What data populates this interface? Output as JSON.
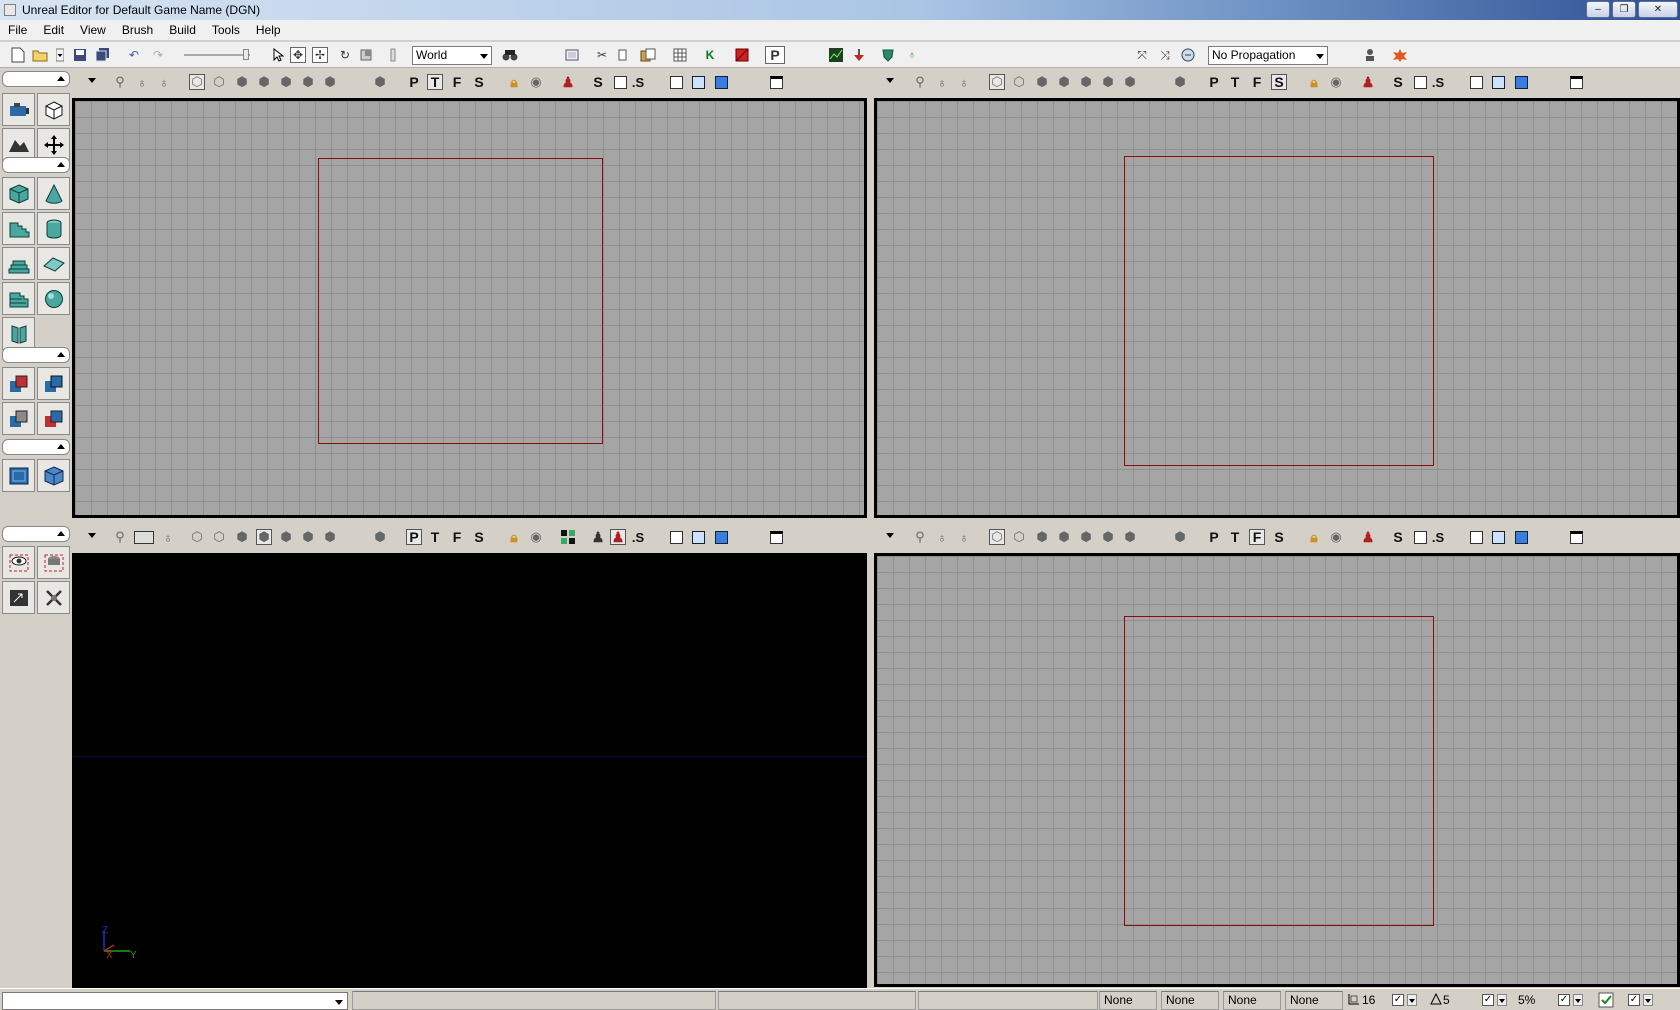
{
  "window": {
    "title": "Unreal Editor for Default Game Name (DGN)",
    "min_glyph": "–",
    "restore_glyph": "❐",
    "close_glyph": "✕"
  },
  "menu": [
    "File",
    "Edit",
    "View",
    "Brush",
    "Build",
    "Tools",
    "Help"
  ],
  "toolbar": {
    "coordinate_system": "World",
    "propagation": "No Propagation",
    "icons": [
      "new-map-icon",
      "open-icon",
      "save-icon",
      "save-all-icon",
      "undo-icon",
      "redo-icon",
      "select-icon",
      "translate-icon",
      "rotate-icon",
      "find-icon",
      "cut-icon",
      "copy-icon",
      "paste-icon",
      "grid-icon",
      "kismet-icon",
      "red-box-icon",
      "play-icon",
      "stats-icon",
      "build-icon",
      "propagate-icon"
    ],
    "p_label": "P"
  },
  "viewports": {
    "top_left": {
      "letters": [
        "P",
        "T",
        "F",
        "S"
      ],
      "pressed": "T",
      "extra_s": "S",
      "dot_s": ".S"
    },
    "top_right": {
      "letters": [
        "P",
        "T",
        "F",
        "S"
      ],
      "pressed": "S",
      "extra_s": "S",
      "dot_s": ".S"
    },
    "bottom_left": {
      "letters": [
        "P",
        "T",
        "F",
        "S"
      ],
      "pressed": "P",
      "dot_s": ".S",
      "axis": {
        "z": "Z",
        "x": "X",
        "y": "Y"
      }
    },
    "bottom_right": {
      "letters": [
        "P",
        "T",
        "F",
        "S"
      ],
      "pressed": "F",
      "extra_s": "S",
      "dot_s": ".S"
    }
  },
  "statusbar": {
    "fields": [
      "None",
      "None",
      "None",
      "None"
    ],
    "grid_size": "16",
    "rotation_snap": "5",
    "scale_snap": "5%",
    "check_glyph": "✓"
  },
  "colors": {
    "grid_bg": "#a5a5a5",
    "grid_line": "#8f8f8f",
    "brush_outline": "#8a0c0c",
    "perspective_bg": "#000000"
  }
}
